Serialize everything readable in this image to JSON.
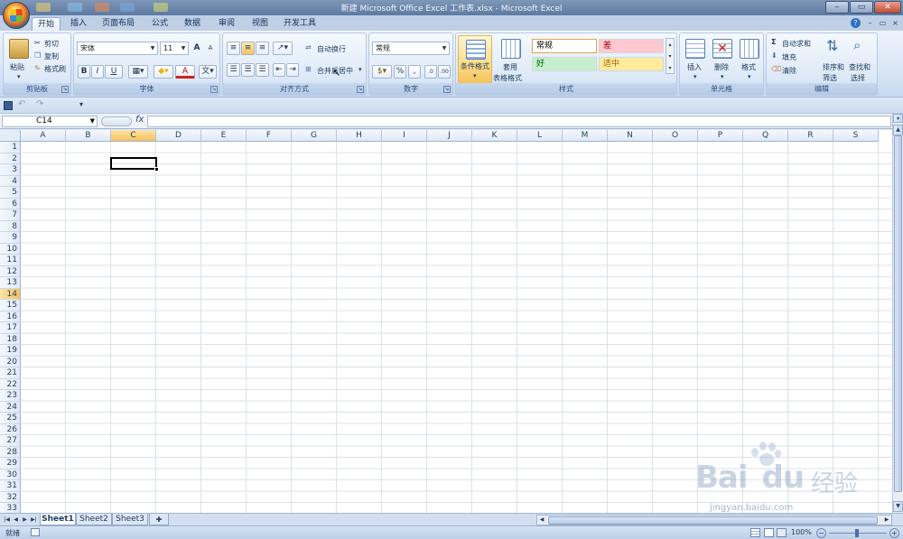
{
  "window": {
    "title": "新建 Microsoft Office Excel 工作表.xlsx - Microsoft Excel",
    "min": "–",
    "max": "▭",
    "close": "✕"
  },
  "tabs": [
    "开始",
    "插入",
    "页面布局",
    "公式",
    "数据",
    "审阅",
    "视图",
    "开发工具"
  ],
  "active_tab": "开始",
  "ribbon": {
    "clipboard": {
      "title": "剪贴板",
      "paste": "粘贴",
      "cut": "剪切",
      "copy": "复制",
      "painter": "格式刷"
    },
    "font": {
      "title": "字体",
      "name": "宋体",
      "size": "11",
      "grow": "A",
      "shrink": "A",
      "bold": "B",
      "italic": "I",
      "underline": "U",
      "color_letter": "A"
    },
    "align": {
      "title": "对齐方式",
      "wrap": "自动换行",
      "merge": "合并后居中"
    },
    "number": {
      "title": "数字",
      "format": "常规",
      "percent": "%",
      "comma": ","
    },
    "styles": {
      "title": "样式",
      "cond": "条件格式",
      "table1": "套用",
      "table2": "表格格式",
      "normal": "常规",
      "bad": "差",
      "good": "好",
      "neutral": "适中"
    },
    "cells": {
      "title": "单元格",
      "insert": "插入",
      "delete": "删除",
      "format": "格式"
    },
    "editing": {
      "title": "编辑",
      "autosum": "自动求和",
      "fill": "填充",
      "clear": "清除",
      "sort1": "排序和",
      "sort2": "筛选",
      "find1": "查找和",
      "find2": "选择"
    }
  },
  "formula_bar": {
    "name_box": "C14",
    "fx": "fx",
    "value": ""
  },
  "columns": [
    "A",
    "B",
    "C",
    "D",
    "E",
    "F",
    "G",
    "H",
    "I",
    "J",
    "K",
    "L",
    "M",
    "N",
    "O",
    "P",
    "Q",
    "R",
    "S"
  ],
  "rows": [
    "1",
    "2",
    "3",
    "4",
    "5",
    "6",
    "7",
    "8",
    "9",
    "10",
    "11",
    "12",
    "13",
    "14",
    "15",
    "16",
    "17",
    "18",
    "19",
    "20",
    "21",
    "22",
    "23",
    "24",
    "25",
    "26",
    "27",
    "28",
    "29",
    "30",
    "31",
    "32",
    "33"
  ],
  "selected": {
    "column": "C",
    "row": "14"
  },
  "sheets": [
    "Sheet1",
    "Sheet2",
    "Sheet3"
  ],
  "active_sheet": "Sheet1",
  "status": {
    "mode": "就绪",
    "zoom": "100%"
  },
  "watermark": {
    "brand": "Bai",
    "suffix": "du",
    "cn": "经验",
    "url": "jingyan.baidu.com"
  },
  "colors": {
    "accent": "#f6c25b",
    "grid": "#dbe2ec",
    "ribbon": "#dce8f6"
  }
}
